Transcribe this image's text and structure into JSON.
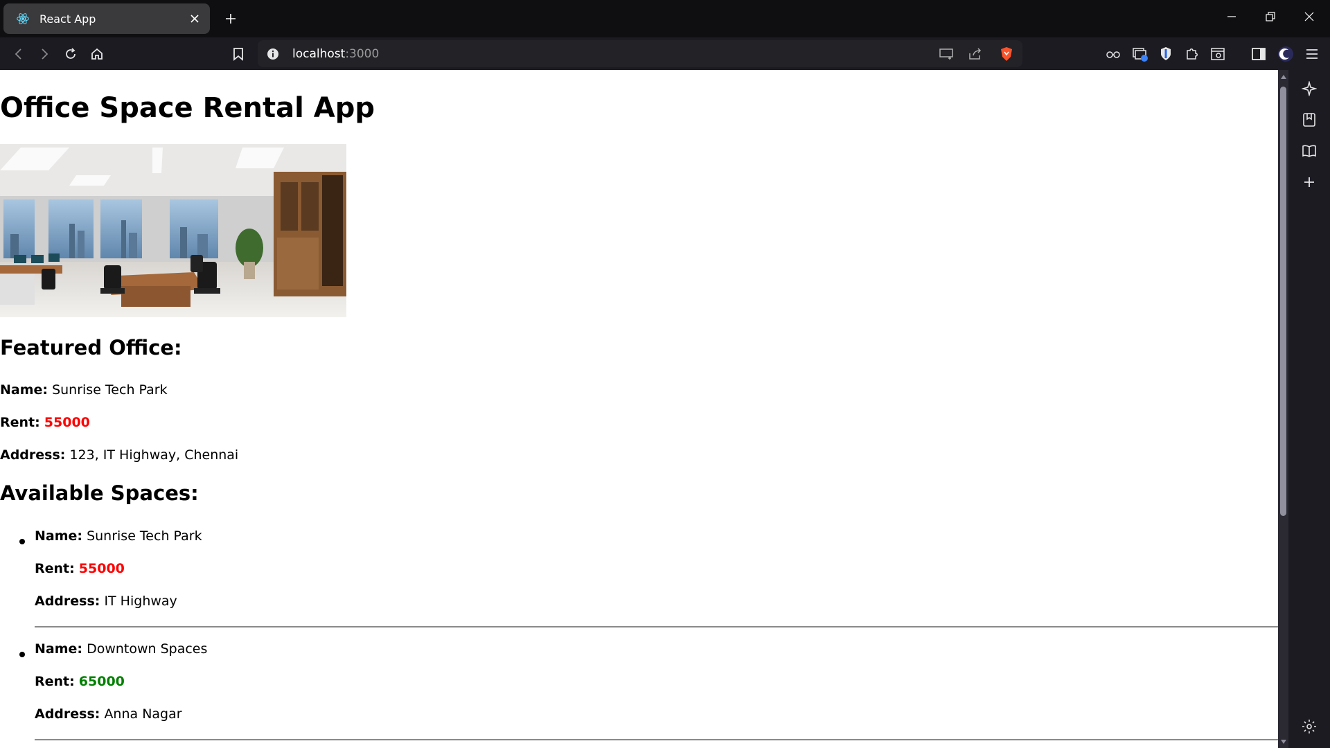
{
  "browser": {
    "tab_title": "React App",
    "url_host": "localhost",
    "url_port": ":3000"
  },
  "page": {
    "heading": "Office Space Rental App",
    "featured_heading": "Featured Office:",
    "featured": {
      "name_label": "Name:",
      "name": "Sunrise Tech Park",
      "rent_label": "Rent:",
      "rent": "55000",
      "address_label": "Address:",
      "address": "123, IT Highway, Chennai"
    },
    "available_heading": "Available Spaces:",
    "spaces": [
      {
        "name_label": "Name:",
        "name": "Sunrise Tech Park",
        "rent_label": "Rent:",
        "rent": "55000",
        "rent_color": "#ff0000",
        "address_label": "Address:",
        "address": "IT Highway"
      },
      {
        "name_label": "Name:",
        "name": "Downtown Spaces",
        "rent_label": "Rent:",
        "rent": "65000",
        "rent_color": "#008000",
        "address_label": "Address:",
        "address": "Anna Nagar"
      }
    ]
  },
  "colors": {
    "rent_high": "#008000",
    "rent_low": "#ff0000",
    "brave_shield": "#fb542b"
  }
}
